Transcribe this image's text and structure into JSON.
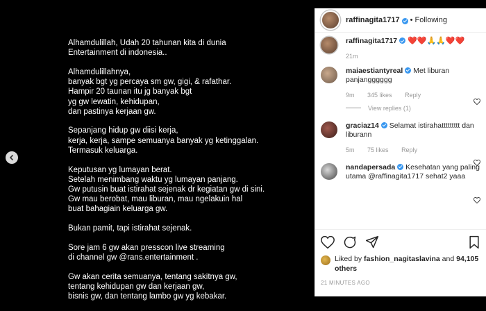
{
  "post": {
    "paragraphs": [
      "Alhamdulillah, Udah 20 tahunan kita  di dunia\nEntertainment di indonesia..",
      "Alhamdulillahnya,\nbanyak bgt yg percaya sm gw, gigi, & rafathar.\nHampir 20 taunan itu jg banyak bgt\nyg gw lewatin, kehidupan,\ndan pastinya  kerjaan gw.",
      "Sepanjang hidup gw diisi kerja,\nkerja, kerja, sampe semuanya banyak yg ketinggalan.\nTermasuk keluarga.",
      "Keputusan yg lumayan berat.\nSetelah menimbang waktu yg lumayan panjang.\nGw putusin buat istirahat sejenak dr kegiatan gw di sini.\nGw mau berobat, mau liburan, mau ngelakuin hal\nbuat bahagiain keluarga gw.",
      "Bukan pamit, tapi istirahat sejenak.",
      "Sore jam 6 gw akan presscon live streaming\ndi channel gw @rans.entertainment .",
      "Gw akan cerita semuanya, tentang sakitnya gw,\ntentang kehidupan gw dan kerjaan gw,\nbisnis gw, dan tentang lambo gw yg kebakar."
    ]
  },
  "header": {
    "username": "raffinagita1717",
    "separator": "•",
    "follow_status": "Following"
  },
  "caption": {
    "username": "raffinagita1717",
    "text": "❤️❤️🙏🙏❤️❤️",
    "time": "21m"
  },
  "comments": [
    {
      "username": "maiaestiantyreal",
      "text": "Met liburan panjangggggg",
      "time": "9m",
      "likes": "345 likes",
      "reply": "Reply",
      "view_replies": "View replies (1)"
    },
    {
      "username": "graciaz14",
      "text": "Selamat istirahattttttttt dan liburann",
      "time": "5m",
      "likes": "75 likes",
      "reply": "Reply"
    },
    {
      "username": "nandapersada",
      "text": "Kesehatan yang paling utama @raffinagita1717 sehat2 yaaa"
    }
  ],
  "likes": {
    "prefix": "Liked by",
    "user": "fashion_nagitaslavina",
    "and": "and",
    "count": "94,105 others"
  },
  "timestamp": "21 MINUTES AGO",
  "colors": {
    "verified": "#3897f0",
    "heart": "#ed4956",
    "meta": "#999999"
  },
  "icons": [
    "chevron-left-icon",
    "heart-icon",
    "comment-icon",
    "share-icon",
    "bookmark-icon"
  ]
}
